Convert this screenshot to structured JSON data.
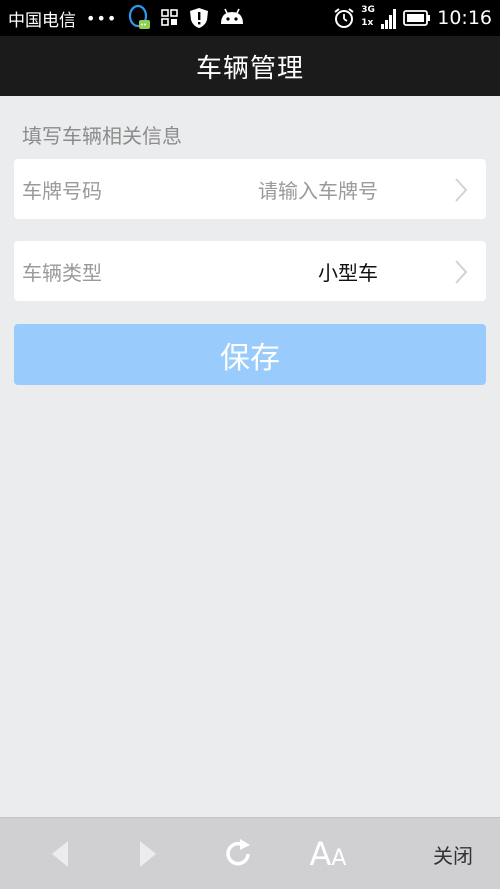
{
  "status_bar": {
    "carrier": "中国电信",
    "dots": "•••",
    "network": "3G",
    "network_sub": "1x",
    "time": "10:16"
  },
  "header": {
    "title": "车辆管理"
  },
  "form": {
    "section_label": "填写车辆相关信息",
    "plate": {
      "label": "车牌号码",
      "placeholder": "请输入车牌号"
    },
    "vehicle_type": {
      "label": "车辆类型",
      "value": "小型车"
    },
    "save_label": "保存"
  },
  "bottom_bar": {
    "font_label": "AA",
    "close_label": "关闭"
  },
  "colors": {
    "status_bar": "#000000",
    "title_bar": "#1b1b1b",
    "background": "#ebecee",
    "save_button": "#99cbfc",
    "bottom_bar": "#d0d0d2"
  },
  "icons": [
    "qq-icon",
    "apps-grid-icon",
    "shield-icon",
    "android-icon",
    "alarm-icon",
    "signal-icon",
    "battery-icon",
    "chevron-right-icon",
    "back-arrow-icon",
    "forward-arrow-icon",
    "refresh-icon"
  ]
}
